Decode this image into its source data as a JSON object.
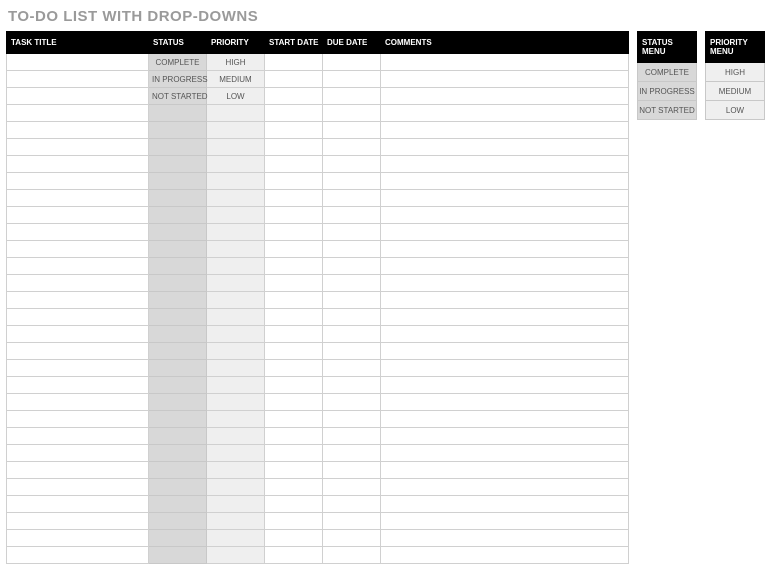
{
  "title": "TO-DO LIST WITH DROP-DOWNS",
  "columns": {
    "task": "TASK TITLE",
    "status": "STATUS",
    "priority": "PRIORITY",
    "start": "START DATE",
    "due": "DUE DATE",
    "comments": "COMMENTS"
  },
  "status_options": [
    "COMPLETE",
    "IN PROGRESS",
    "NOT STARTED"
  ],
  "priority_options": [
    "HIGH",
    "MEDIUM",
    "LOW"
  ],
  "rows": [
    {
      "task": "",
      "status": "COMPLETE",
      "priority": "HIGH",
      "start": "",
      "due": "",
      "comments": ""
    },
    {
      "task": "",
      "status": "IN PROGRESS",
      "priority": "MEDIUM",
      "start": "",
      "due": "",
      "comments": ""
    },
    {
      "task": "",
      "status": "NOT STARTED",
      "priority": "LOW",
      "start": "",
      "due": "",
      "comments": ""
    },
    {
      "task": "",
      "status": "",
      "priority": "",
      "start": "",
      "due": "",
      "comments": ""
    },
    {
      "task": "",
      "status": "",
      "priority": "",
      "start": "",
      "due": "",
      "comments": ""
    },
    {
      "task": "",
      "status": "",
      "priority": "",
      "start": "",
      "due": "",
      "comments": ""
    },
    {
      "task": "",
      "status": "",
      "priority": "",
      "start": "",
      "due": "",
      "comments": ""
    },
    {
      "task": "",
      "status": "",
      "priority": "",
      "start": "",
      "due": "",
      "comments": ""
    },
    {
      "task": "",
      "status": "",
      "priority": "",
      "start": "",
      "due": "",
      "comments": ""
    },
    {
      "task": "",
      "status": "",
      "priority": "",
      "start": "",
      "due": "",
      "comments": ""
    },
    {
      "task": "",
      "status": "",
      "priority": "",
      "start": "",
      "due": "",
      "comments": ""
    },
    {
      "task": "",
      "status": "",
      "priority": "",
      "start": "",
      "due": "",
      "comments": ""
    },
    {
      "task": "",
      "status": "",
      "priority": "",
      "start": "",
      "due": "",
      "comments": ""
    },
    {
      "task": "",
      "status": "",
      "priority": "",
      "start": "",
      "due": "",
      "comments": ""
    },
    {
      "task": "",
      "status": "",
      "priority": "",
      "start": "",
      "due": "",
      "comments": ""
    },
    {
      "task": "",
      "status": "",
      "priority": "",
      "start": "",
      "due": "",
      "comments": ""
    },
    {
      "task": "",
      "status": "",
      "priority": "",
      "start": "",
      "due": "",
      "comments": ""
    },
    {
      "task": "",
      "status": "",
      "priority": "",
      "start": "",
      "due": "",
      "comments": ""
    },
    {
      "task": "",
      "status": "",
      "priority": "",
      "start": "",
      "due": "",
      "comments": ""
    },
    {
      "task": "",
      "status": "",
      "priority": "",
      "start": "",
      "due": "",
      "comments": ""
    },
    {
      "task": "",
      "status": "",
      "priority": "",
      "start": "",
      "due": "",
      "comments": ""
    },
    {
      "task": "",
      "status": "",
      "priority": "",
      "start": "",
      "due": "",
      "comments": ""
    },
    {
      "task": "",
      "status": "",
      "priority": "",
      "start": "",
      "due": "",
      "comments": ""
    },
    {
      "task": "",
      "status": "",
      "priority": "",
      "start": "",
      "due": "",
      "comments": ""
    },
    {
      "task": "",
      "status": "",
      "priority": "",
      "start": "",
      "due": "",
      "comments": ""
    },
    {
      "task": "",
      "status": "",
      "priority": "",
      "start": "",
      "due": "",
      "comments": ""
    },
    {
      "task": "",
      "status": "",
      "priority": "",
      "start": "",
      "due": "",
      "comments": ""
    },
    {
      "task": "",
      "status": "",
      "priority": "",
      "start": "",
      "due": "",
      "comments": ""
    },
    {
      "task": "",
      "status": "",
      "priority": "",
      "start": "",
      "due": "",
      "comments": ""
    },
    {
      "task": "",
      "status": "",
      "priority": "",
      "start": "",
      "due": "",
      "comments": ""
    }
  ],
  "side": {
    "status_header": "STATUS MENU",
    "priority_header": "PRIORITY MENU"
  }
}
